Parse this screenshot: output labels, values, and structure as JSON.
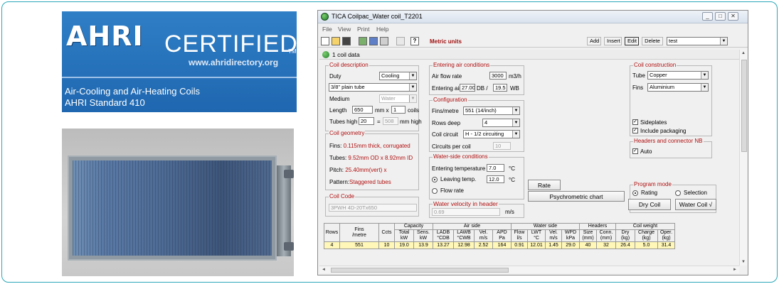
{
  "ahri": {
    "logo": "AHRI",
    "certified": "CERTIFIED",
    "tm": "TM",
    "url": "www.ahridirectory.org",
    "desc_line1": "Air-Cooling and Air-Heating Coils",
    "desc_line2": "AHRI Standard 410"
  },
  "window": {
    "title": "TICA Coilpac_Water coil_T2201",
    "controls": [
      "_",
      "□",
      "✕"
    ]
  },
  "menu": [
    "File",
    "View",
    "Print",
    "Help"
  ],
  "toolbar": {
    "metric_units": "Metric units",
    "add": "Add",
    "insert": "Insert",
    "edit": "Edit",
    "delete": "Delete",
    "project": "test"
  },
  "sheet": {
    "title": "1 coil data"
  },
  "coil_description": {
    "title": "Coil description",
    "duty_label": "Duty",
    "duty_value": "Cooling",
    "tube_type": "3/8\" plain tube",
    "medium_label": "Medium",
    "medium_value": "Water",
    "length_label": "Length",
    "length_value": "650",
    "length_unit": "mm x",
    "coils_value": "1",
    "coils_label": "coils",
    "tubes_high_label": "Tubes high",
    "tubes_high_value": "20",
    "equals": "=",
    "height_value": "508",
    "height_unit": "mm high"
  },
  "coil_geometry": {
    "title": "Coil geometry",
    "fins_label": "Fins:",
    "fins_value": "0.115mm thick, corrugated",
    "tubes_label": "Tubes:",
    "tubes_value": "9.52mm OD x 8.92mm ID",
    "pitch_label": "Pitch:",
    "pitch_value": "25.40mm(vert) x",
    "pattern_label": "Pattern:",
    "pattern_value": "Staggered tubes"
  },
  "coil_code": {
    "title": "Coil Code",
    "value": "3PWH 4D-20Tx650"
  },
  "entering_air": {
    "title": "Entering air conditions",
    "airflow_label": "Air flow rate",
    "airflow_value": "3000",
    "airflow_unit": "m3/h",
    "entering_label": "Entering air",
    "db_value": "27.00",
    "db_label": "DB /",
    "wb_value": "19.5",
    "wb_label": "WB"
  },
  "configuration": {
    "title": "Configuration",
    "fins_label": "Fins/metre",
    "fins_value": "551 (14/inch)",
    "rows_label": "Rows deep",
    "rows_value": "4",
    "circuit_label": "Coil circuit",
    "circuit_value": "H - 1/2 circuiting",
    "circuits_label": "Circuits per coil",
    "circuits_value": "10"
  },
  "water_side": {
    "title": "Water-side conditions",
    "entering_label": "Entering temperature",
    "entering_value": "7.0",
    "entering_unit": "°C",
    "leaving_label": "Leaving temp.",
    "leaving_value": "12.0",
    "leaving_unit": "°C",
    "flow_label": "Flow rate"
  },
  "water_velocity": {
    "title": "Water velocity in header",
    "value": "0.69",
    "unit": "m/s"
  },
  "rate_button": "Rate",
  "psychrometric_button": "Psychrometric chart",
  "coil_construction": {
    "title": "Coil construction",
    "tube_label": "Tube",
    "tube_value": "Copper",
    "fins_label": "Fins",
    "fins_value": "Aluminium",
    "sideplates_label": "Sideplates",
    "packaging_label": "Include packaging"
  },
  "headers_nb": {
    "title": "Headers and connector NB",
    "auto_label": "Auto"
  },
  "program_mode": {
    "title": "Program mode",
    "rating_label": "Rating",
    "selection_label": "Selection",
    "dry_coil": "Dry Coil",
    "water_coil": "Water Coil √"
  },
  "results": {
    "groups": [
      "Capacity",
      "Air side",
      "Water side",
      "Headers",
      "Coil weight"
    ],
    "columns": [
      [
        "Rows",
        ""
      ],
      [
        "Fins",
        "/metre"
      ],
      [
        "Ccts",
        ""
      ],
      [
        "Total",
        "kW"
      ],
      [
        "Sens.",
        "kW"
      ],
      [
        "LADB",
        "°CDB"
      ],
      [
        "LAWB",
        "°CWB"
      ],
      [
        "Vel.",
        "m/s"
      ],
      [
        "APD",
        "Pa"
      ],
      [
        "Flow",
        "l/s"
      ],
      [
        "LWT",
        "°C"
      ],
      [
        "Vel.",
        "m/s"
      ],
      [
        "WPD",
        "kPa"
      ],
      [
        "Size",
        "(mm)"
      ],
      [
        "Conn.",
        "(mm)"
      ],
      [
        "Dry",
        "(kg)"
      ],
      [
        "Charge",
        "(kg)"
      ],
      [
        "Oper.",
        "(kg)"
      ]
    ],
    "row": [
      "4",
      "551",
      "10",
      "19.0",
      "13.9",
      "13.27",
      "12.98",
      "2.52",
      "164",
      "0.91",
      "12.01",
      "1.45",
      "29.0",
      "40",
      "32",
      "26.4",
      "5.0",
      "31.4"
    ]
  },
  "colors": {
    "ahri_blue": "#1f67b0",
    "group_title_red": "#b01010",
    "result_row_yellow": "#fff7b8",
    "frame_teal": "#2aa7b8"
  },
  "icons": [
    "app-icon",
    "new-file-icon",
    "open-folder-icon",
    "save-icon",
    "printer-icon",
    "help-icon"
  ]
}
